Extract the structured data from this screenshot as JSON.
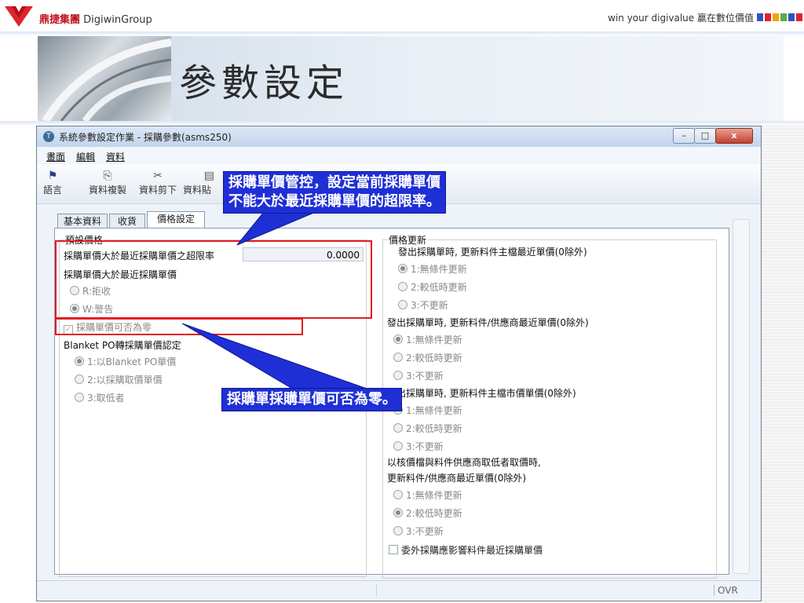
{
  "brand": {
    "logo_name": "鼎捷集團",
    "logo_suffix": "DigiwinGroup",
    "slogan": "win your digivalue 赢在數位價值",
    "square_colors": [
      "#2f55c4",
      "#e0232b",
      "#f4a300",
      "#56b13f",
      "#2f55c4",
      "#e0232b"
    ]
  },
  "slide": {
    "title": "參數設定"
  },
  "window": {
    "title": "系統參數設定作業 - 採購參數(asms250)",
    "buttons": {
      "minimize": "–",
      "maximize": "□",
      "close": "x"
    },
    "menu": [
      "畫面",
      "編輯",
      "資料"
    ],
    "toolbar": [
      {
        "label": "語言",
        "icon": "flag-icon"
      },
      {
        "label": "資料複製",
        "icon": "copy-icon"
      },
      {
        "label": "資料剪下",
        "icon": "scissors-icon"
      },
      {
        "label": "資料貼",
        "icon": "paste-icon"
      }
    ],
    "tabs": [
      "基本資料",
      "收貨",
      "價格設定"
    ]
  },
  "form": {
    "left_group_title": "預設價格",
    "rate_label": "採購單價大於最近採購單價之超限率",
    "rate_value": "0.0000",
    "price_exceed_label": "採購單價大於最近採購單價",
    "exceed_options": [
      "R:拒收",
      "W:警告"
    ],
    "zero_price_label": "採購單價可否為零",
    "blanket_label": "Blanket PO轉採購單價認定",
    "blanket_options": [
      "1:以Blanket PO單價",
      "2:以採購取價單價",
      "3:取低者"
    ],
    "right_group_title": "價格更新",
    "update_groups": [
      {
        "title": "發出採購單時, 更新料件主檔最近單價(0除外)",
        "options": [
          "1:無條件更新",
          "2:較低時更新",
          "3:不更新"
        ],
        "selected": 0
      },
      {
        "title": "發出採購單時, 更新料件/供應商最近單價(0除外)",
        "options": [
          "1:無條件更新",
          "2:較低時更新",
          "3:不更新"
        ],
        "selected": 0
      },
      {
        "title": "發出採購單時, 更新料件主檔市價單價(0除外)",
        "options": [
          "1:無條件更新",
          "2:較低時更新",
          "3:不更新"
        ],
        "selected": -1
      },
      {
        "title_line1": "以核價檔與料件供應商取低者取價時,",
        "title": "更新料件/供應商最近單價(0除外)",
        "options": [
          "1:無條件更新",
          "2:較低時更新",
          "3:不更新"
        ],
        "selected": 1
      }
    ],
    "outsource_label": "委外採購應影響料件最近採購單價",
    "status_ovr": "OVR"
  },
  "annotations": {
    "callout_top_line1": "採購單價管控，設定當前採購單價",
    "callout_top_line2": "不能大於最近採購單價的超限率。",
    "callout_bottom": "採購單採購單價可否為零。"
  }
}
